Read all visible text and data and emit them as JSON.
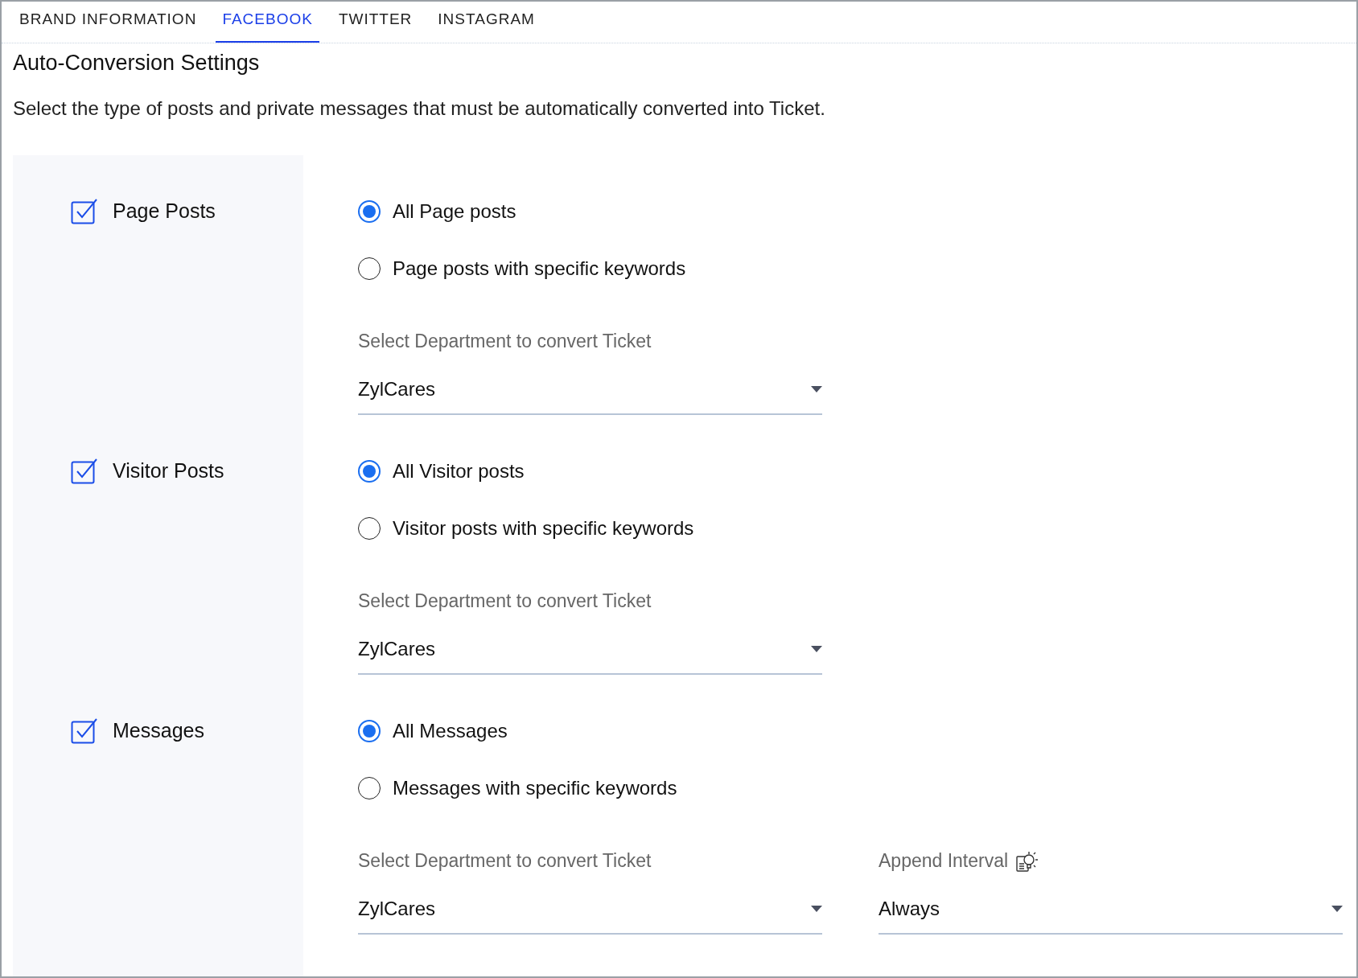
{
  "tabs": [
    {
      "label": "BRAND INFORMATION",
      "selected": false
    },
    {
      "label": "FACEBOOK",
      "selected": true
    },
    {
      "label": "TWITTER",
      "selected": false
    },
    {
      "label": "INSTAGRAM",
      "selected": false
    }
  ],
  "title": "Auto-Conversion Settings",
  "description": "Select the type of posts and private messages that must be automatically converted into Ticket.",
  "sections": [
    {
      "label": "Page Posts",
      "checked": true,
      "options": [
        {
          "label": "All Page posts",
          "selected": true
        },
        {
          "label": "Page posts with specific keywords",
          "selected": false
        }
      ],
      "fields": [
        {
          "label": "Select Department to convert Ticket",
          "value": "ZylCares",
          "hint_icon": false
        }
      ]
    },
    {
      "label": "Visitor Posts",
      "checked": true,
      "options": [
        {
          "label": "All Visitor posts",
          "selected": true
        },
        {
          "label": "Visitor posts with specific keywords",
          "selected": false
        }
      ],
      "fields": [
        {
          "label": "Select Department to convert Ticket",
          "value": "ZylCares",
          "hint_icon": false
        }
      ]
    },
    {
      "label": "Messages",
      "checked": true,
      "options": [
        {
          "label": "All Messages",
          "selected": true
        },
        {
          "label": "Messages with specific keywords",
          "selected": false
        }
      ],
      "fields": [
        {
          "label": "Select Department to convert Ticket",
          "value": "ZylCares",
          "hint_icon": false
        },
        {
          "label": "Append Interval",
          "value": "Always",
          "hint_icon": true
        }
      ]
    }
  ]
}
